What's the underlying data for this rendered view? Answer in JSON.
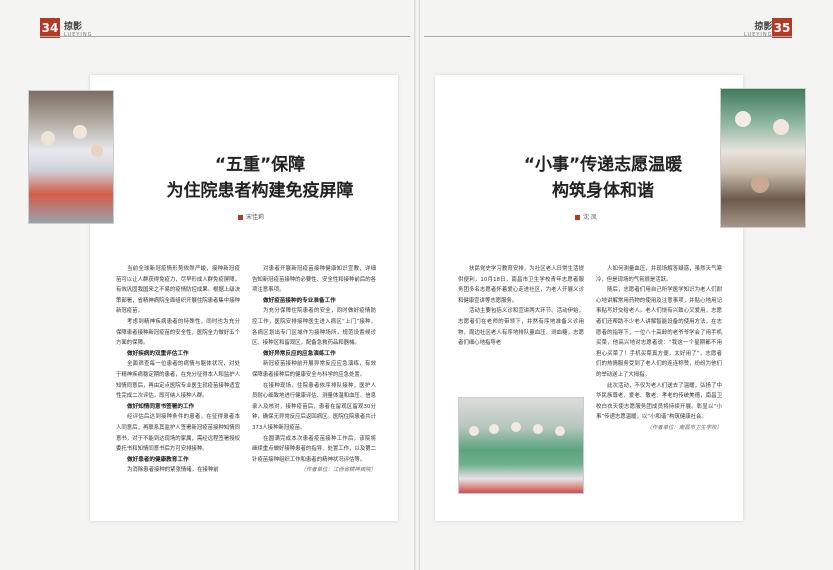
{
  "left_page": {
    "page_number": "34",
    "section_zh": "掠影",
    "section_en": "LUEYING",
    "title_line1": "“五重”保障",
    "title_line2": "为住院患者构建免疫屏障",
    "author": "宋佳莉",
    "col1": [
      {
        "type": "p",
        "text": "当前全球新冠疫情形势依然严峻，接种新冠疫苗可以让人群获得免疫力，尽早形成人群免疫屏障，有效巩固我国来之不易的疫情防控成果。根据上级决策部署，省精神病院全面组织开展住院患者集中接种新冠疫苗。"
      },
      {
        "type": "p",
        "text": "考虑到精神疾病患者的特殊性，同时也为充分保障患者接种新冠疫苗的安全性，医院全力做好五个方面的保障。"
      },
      {
        "type": "h",
        "text": "做好疾病的双重评估工作"
      },
      {
        "type": "p",
        "text": "全面筛查每一位患者的病情与躯体状况，对处于精神疾病稳定期的患者，在充分征得本人和监护人知情同意后，再由定点医院专业医生就疫苗接种适宜性完成二次评估，即可纳入接种人群。"
      },
      {
        "type": "h",
        "text": "做好知情同意书签署的工作"
      },
      {
        "type": "p",
        "text": "经评估后达到接种条件的患者，在征得患者本人同意后，再联系其监护人签署新冠疫苗接种知情同意书，对于不能到达现场的家属，需经远程签署授权委托书和知情同意书后方可安排接种。"
      },
      {
        "type": "h",
        "text": "做好患者的健康教育工作"
      },
      {
        "type": "p",
        "text": "为消除患者接种的紧张情绪，在接种前"
      }
    ],
    "col2": [
      {
        "type": "p",
        "text": "对患者开展新冠疫苗接种健康知识宣教，详细告知新冠疫苗接种的必要性、安全性和接种前后的各项注意事项。"
      },
      {
        "type": "h",
        "text": "做好疫苗接种的专业准备工作"
      },
      {
        "type": "p",
        "text": "为充分保障住院患者的安全，同时做好疫情防控工作，医院安排接种医生进入病区“上门”接种，各病区划出专门区域作为接种场所，规范设置候诊区、接种区和留观区，配备急救药品和器械。"
      },
      {
        "type": "h",
        "text": "做好异常反应的应急演练工作"
      },
      {
        "type": "p",
        "text": "新冠疫苗接种前开展异常反应应急演练，有效保障患者接种后的健康安全与科学的应急处置。"
      },
      {
        "type": "p",
        "text": "在接种现场，住院患者依序排队接种，医护人员耐心细致地进行健康评估、测量体温和血压、信息录入及核对，接种疫苗后，患者在留观区留观30分钟，确保无异常反应后返回病区。医院住院患者共计373人接种新冠疫苗。"
      },
      {
        "type": "p",
        "text": "在圆满完成本次患者疫苗接种工作后，该院将继续重点做好接种患者的指导、处置工作，以及第二针疫苗接种组织工作和患者的精神状况评估等。"
      },
      {
        "type": "note",
        "text": "（作者单位：江西省精神病院）"
      }
    ]
  },
  "right_page": {
    "page_number": "35",
    "section_zh": "掠影",
    "section_en": "LUEYING",
    "title_line1": "“小事”传递志愿温暖",
    "title_line2": "构筑身体和谐",
    "author": "沈 凤",
    "col3": [
      {
        "type": "p",
        "text": "扶民党史学习教育安排，为社区老人日常生活提供便利，10月18日，南昌市卫生学校青年志愿者服务团多名志愿者怀着爱心走进社区，为老人开展义诊和健康宣讲等志愿服务。"
      },
      {
        "type": "p",
        "text": "活动主要包括义诊和宣讲两大环节。活动伊始，志愿者们在老师的带领下，井然有序地准备义诊用物，周边社区老人有序地排队量血压、测血糖，志愿者们细心地指导老"
      }
    ],
    "col4": [
      {
        "type": "p",
        "text": "人如何测量血压，并现场解答疑惑，虽然天气寒冷，但是现场的气氛很是活跃。"
      },
      {
        "type": "p",
        "text": "随后，志愿者们用自己所学医学知识为老人们耐心地讲解常用药物的使用及注意事项，并贴心地用记事贴写好交给老人。老人们饶有兴致心又爱用，志愿者们还帮助不少老人讲解智能设备的使用方法，在志愿者的指导下，一位八十高龄的老爷爷学会了用手机买菜，他高兴地对志愿者说：“我这一个星期都不用担心买菜了！手机买菜真方便，太好用了”，志愿者们的热情服务受到了老人们的连连称赞，纷纷为他们的举动送上了大拇指。"
      },
      {
        "type": "p",
        "text": "此次活动，不仅为老人们送去了温暖，弘扬了中华民族尊老、爱老、敬老、孝老的传统美德，南昌卫校白衣天使志愿服务团成员将持续开展。彰显以“小事”传递志愿温暖，以“小和谐”构筑健康社会。"
      },
      {
        "type": "note",
        "text": "（作者单位：南昌市卫生学校）"
      }
    ]
  }
}
